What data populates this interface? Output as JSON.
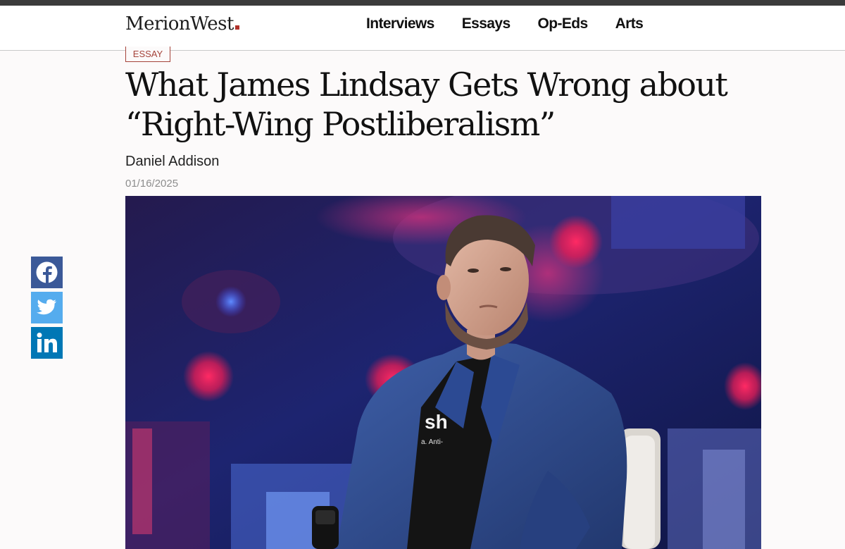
{
  "header": {
    "logo": "MerionWest",
    "nav": [
      "Interviews",
      "Essays",
      "Op-Eds",
      "Arts"
    ]
  },
  "article": {
    "category": "ESSAY",
    "title": "What James Lindsay Gets Wrong about “Right-Wing Postliberalism”",
    "author": "Daniel Addison",
    "date": "01/16/2025",
    "hero_shirt_text": "sh",
    "hero_shirt_subtext": "a. Anti-"
  },
  "share": {
    "icons": [
      "facebook-icon",
      "twitter-icon",
      "linkedin-icon"
    ]
  },
  "colors": {
    "accent": "#a5433a",
    "facebook": "#3b5998",
    "twitter": "#55acee",
    "linkedin": "#0077b5"
  }
}
